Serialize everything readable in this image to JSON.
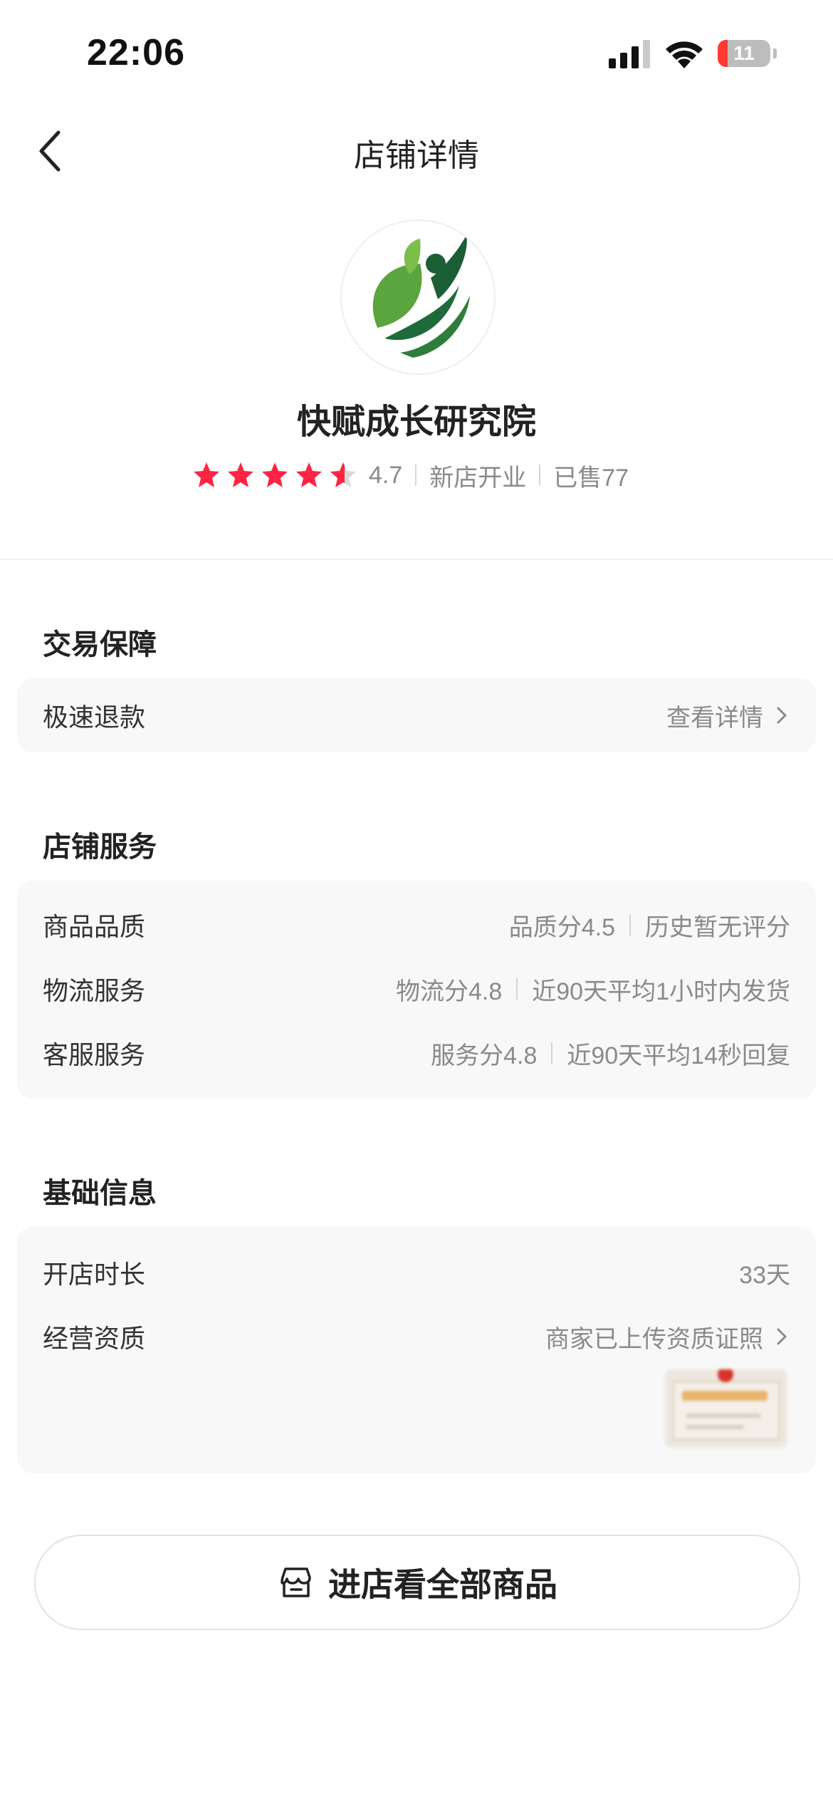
{
  "status_bar": {
    "time": "22:06",
    "battery": "11"
  },
  "nav": {
    "title": "店铺详情"
  },
  "shop": {
    "name": "快赋成长研究院",
    "rating": "4.7",
    "tag": "新店开业",
    "sold": "已售77"
  },
  "sections": {
    "trade": {
      "title": "交易保障",
      "row": {
        "label": "极速退款",
        "value": "查看详情"
      }
    },
    "service": {
      "title": "店铺服务",
      "rows": [
        {
          "label": "商品品质",
          "score": "品质分4.5",
          "desc": "历史暂无评分"
        },
        {
          "label": "物流服务",
          "score": "物流分4.8",
          "desc": "近90天平均1小时内发货"
        },
        {
          "label": "客服服务",
          "score": "服务分4.8",
          "desc": "近90天平均14秒回复"
        }
      ]
    },
    "basic": {
      "title": "基础信息",
      "rows": [
        {
          "label": "开店时长",
          "value": "33天"
        },
        {
          "label": "经营资质",
          "value": "商家已上传资质证照"
        }
      ]
    }
  },
  "enter_button": {
    "label": "进店看全部商品"
  },
  "colors": {
    "star": "#ff2442",
    "star_empty": "#d9d9d9",
    "logo_green": "#2f7d3a"
  }
}
